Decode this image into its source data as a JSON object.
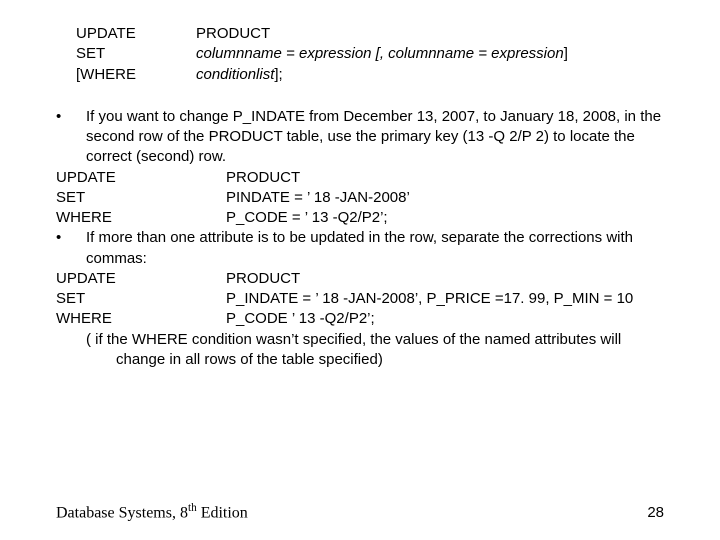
{
  "syntax": {
    "r1k": "UPDATE",
    "r1v": "PRODUCT",
    "r2k": "SET",
    "r2v_a": "columnname = expression [, columnname = expression",
    "r2v_b": "]",
    "r3k": "[WHERE",
    "r3v_a": "conditionlist",
    "r3v_b": "];"
  },
  "bullet1": "If you want to change P_INDATE from December 13, 2007, to January 18, 2008, in the second row of the PRODUCT table,  use the primary key (13 -Q 2/P 2) to locate the correct (second) row.",
  "ex1": {
    "r1k": "UPDATE",
    "r1v": "PRODUCT",
    "r2k": "SET",
    "r2v": "PINDATE = ’ 18 -JAN-2008’",
    "r3k": "WHERE",
    "r3v": "P_CODE = ’ 13 -Q2/P2’;"
  },
  "bullet2": "If more than one attribute is to be updated in the row, separate the corrections with commas:",
  "ex2": {
    "r1k": "UPDATE",
    "r1v": "PRODUCT",
    "r2k": "SET",
    "r2v": "P_INDATE = ’ 18 -JAN-2008’, P_PRICE =17. 99, P_MIN = 10",
    "r3k": "WHERE",
    "r3v": "P_CODE ’ 13 -Q2/P2’;"
  },
  "note": "( if the WHERE condition wasn’t specified, the values of the named attributes will change in all rows of the table specified)",
  "footer": {
    "book_a": "Database Systems, 8",
    "book_b": "th",
    "book_c": " Edition",
    "page": "28"
  },
  "chart_data": {
    "type": "table",
    "title": "SQL UPDATE syntax and examples",
    "syntax": {
      "UPDATE": "PRODUCT",
      "SET": "columnname = expression [, columnname = expression]",
      "[WHERE": "conditionlist];"
    },
    "examples": [
      {
        "description": "Change P_INDATE from December 13, 2007 to January 18, 2008 in the second row of PRODUCT using primary key 13-Q2/P2",
        "UPDATE": "PRODUCT",
        "SET": "PINDATE = '18-JAN-2008'",
        "WHERE": "P_CODE = '13-Q2/P2';"
      },
      {
        "description": "Update multiple attributes in one row, separated by commas",
        "UPDATE": "PRODUCT",
        "SET": "P_INDATE = '18-JAN-2008', P_PRICE = 17.99, P_MIN = 10",
        "WHERE": "P_CODE '13-Q2/P2';"
      }
    ],
    "note": "If the WHERE condition wasn’t specified, the values of the named attributes will change in all rows of the table specified"
  }
}
